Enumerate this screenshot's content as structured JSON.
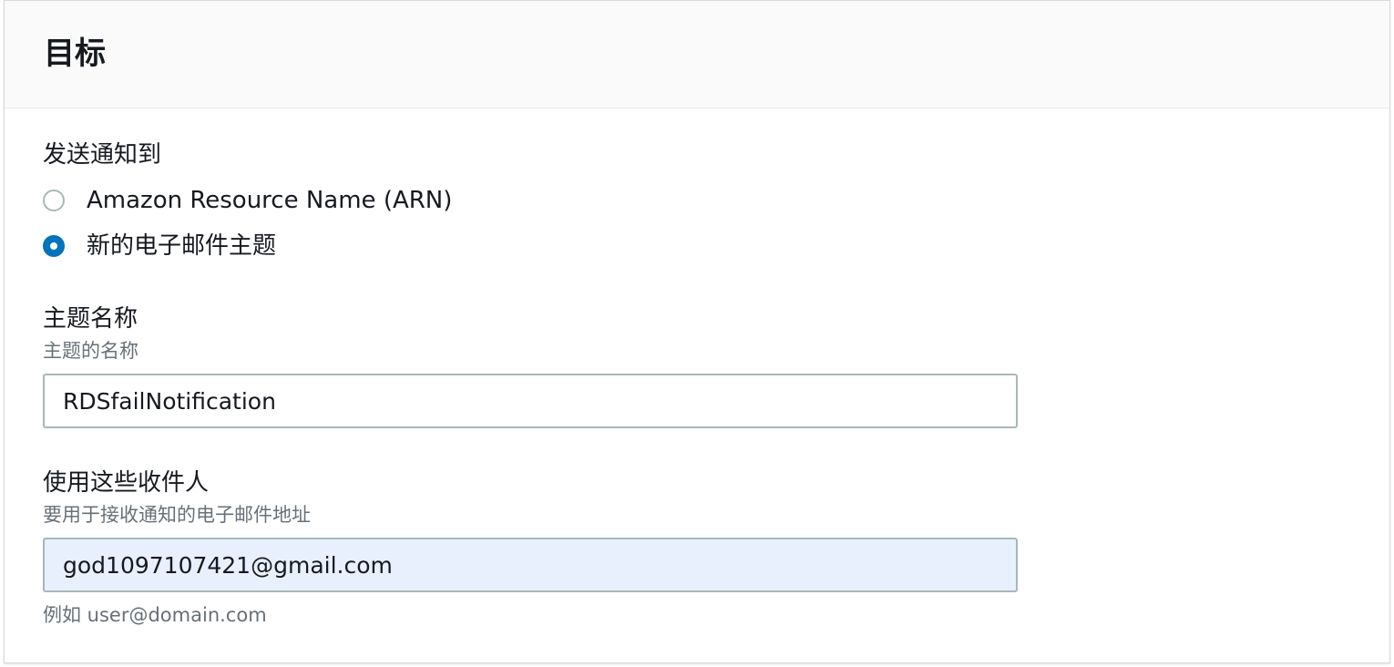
{
  "panel": {
    "title": "目标"
  },
  "send_to": {
    "label": "发送通知到",
    "options": [
      {
        "label": "Amazon Resource Name (ARN)",
        "selected": false
      },
      {
        "label": "新的电子邮件主题",
        "selected": true
      }
    ]
  },
  "topic_name": {
    "label": "主题名称",
    "description": "主题的名称",
    "value": "RDSfailNotification"
  },
  "recipients": {
    "label": "使用这些收件人",
    "description": "要用于接收通知的电子邮件地址",
    "value": "god1097107421@gmail.com",
    "hint": "例如 user@domain.com"
  },
  "colors": {
    "accent": "#0073bb",
    "autofill_background": "#e8f0fe",
    "secondary_text": "#687078"
  }
}
